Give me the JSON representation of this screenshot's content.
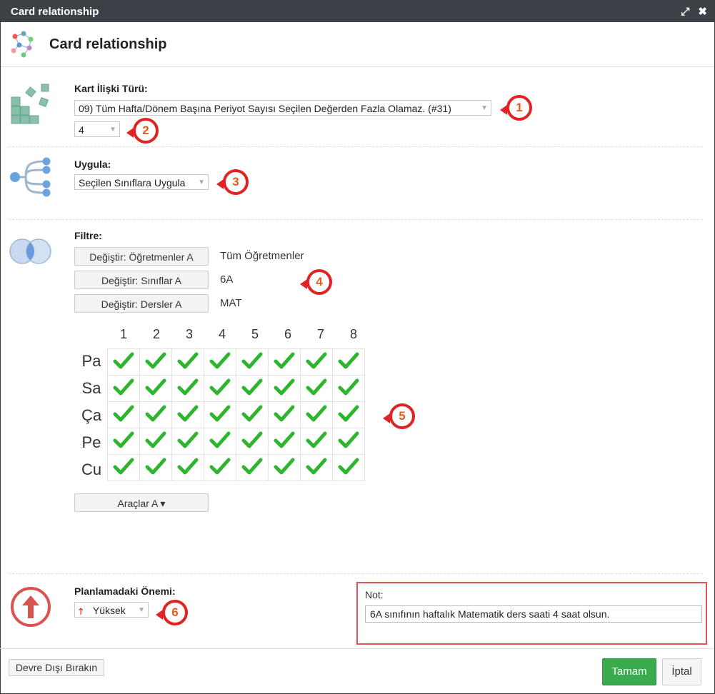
{
  "window": {
    "title": "Card relationship"
  },
  "header": {
    "title": "Card relationship"
  },
  "relation": {
    "label": "Kart İlişki Türü:",
    "type_value": "09) Tüm Hafta/Dönem Başına Periyot Sayısı Seçilen Değerden Fazla Olamaz. (#31)",
    "count_value": "4"
  },
  "apply": {
    "label": "Uygula:",
    "value": "Seçilen Sınıflara Uygula"
  },
  "filter": {
    "label": "Filtre:",
    "rows": [
      {
        "button": "Değiştir: Öğretmenler A",
        "value": "Tüm Öğretmenler"
      },
      {
        "button": "Değiştir: Sınıflar A",
        "value": "6A"
      },
      {
        "button": "Değiştir: Dersler A",
        "value": "MAT"
      }
    ]
  },
  "grid": {
    "columns": [
      "1",
      "2",
      "3",
      "4",
      "5",
      "6",
      "7",
      "8"
    ],
    "rows": [
      "Pa",
      "Sa",
      "Ça",
      "Pe",
      "Cu"
    ],
    "checked": [
      [
        true,
        true,
        true,
        true,
        true,
        true,
        true,
        true
      ],
      [
        true,
        true,
        true,
        true,
        true,
        true,
        true,
        true
      ],
      [
        true,
        true,
        true,
        true,
        true,
        true,
        true,
        true
      ],
      [
        true,
        true,
        true,
        true,
        true,
        true,
        true,
        true
      ],
      [
        true,
        true,
        true,
        true,
        true,
        true,
        true,
        true
      ]
    ]
  },
  "tools_button": "Araçlar A ▾",
  "importance": {
    "label": "Planlamadaki Önemi:",
    "value": "Yüksek"
  },
  "note": {
    "label": "Not:",
    "value": "6A sınıfının haftalık Matematik ders saati 4 saat olsun."
  },
  "badges": [
    "1",
    "2",
    "3",
    "4",
    "5",
    "6"
  ],
  "footer": {
    "disable_label": "Devre Dışı Bırakın",
    "ok_label": "Tamam",
    "cancel_label": "İptal"
  },
  "colors": {
    "titlebar": "#3b4147",
    "check": "#2db52d",
    "ok": "#3aaa4e",
    "badge": "#e02424",
    "icon": "#8cbfa8"
  }
}
